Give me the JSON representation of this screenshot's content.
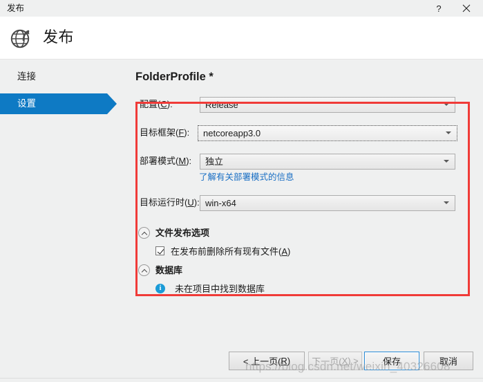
{
  "window": {
    "title": "发布",
    "help_label": "?",
    "close_label": "✕"
  },
  "header": {
    "title": "发布",
    "icon": "globe-publish-icon"
  },
  "sidebar": {
    "items": [
      {
        "label": "连接",
        "selected": false
      },
      {
        "label": "设置",
        "selected": true
      }
    ]
  },
  "main": {
    "profile_title": "FolderProfile *",
    "fields": [
      {
        "label_prefix": "配置(",
        "accel": "C",
        "label_suffix": "):",
        "value": "Release",
        "focused": false
      },
      {
        "label_prefix": "目标框架(",
        "accel": "F",
        "label_suffix": "):",
        "value": "netcoreapp3.0",
        "focused": true
      },
      {
        "label_prefix": "部署模式(",
        "accel": "M",
        "label_suffix": "):",
        "value": "独立",
        "focused": false
      },
      {
        "label_prefix": "目标运行时(",
        "accel": "U",
        "label_suffix": "):",
        "value": "win-x64",
        "focused": false
      }
    ],
    "deployment_hint_link": "了解有关部署模式的信息",
    "sections": [
      {
        "title": "文件发布选项",
        "checkbox": {
          "label_prefix": "在发布前删除所有现有文件(",
          "accel": "A",
          "label_suffix": ")",
          "checked": true
        }
      },
      {
        "title": "数据库",
        "info": {
          "icon": "info-icon",
          "glyph": "i",
          "text": "未在项目中找到数据库"
        }
      }
    ]
  },
  "footer": {
    "buttons": [
      {
        "name": "previous",
        "label": "< 上一页(R)",
        "prefix": "< 上一页(",
        "accel": "R",
        "suffix": ")",
        "state": "enabled"
      },
      {
        "name": "next",
        "label": "下一页(X) >",
        "prefix": "下一页(",
        "accel": "X",
        "suffix": ") >",
        "state": "disabled"
      },
      {
        "name": "save",
        "label": "保存",
        "prefix": "保存",
        "accel": "",
        "suffix": "",
        "state": "focused"
      },
      {
        "name": "cancel",
        "label": "取消",
        "prefix": "取消",
        "accel": "",
        "suffix": "",
        "state": "enabled"
      }
    ]
  },
  "watermark": "https://blog.csdn.net/weixin_40326608",
  "colors": {
    "accent_blue": "#0e7ac4",
    "link_blue": "#1a6fc4",
    "annotation_red": "#f03b38",
    "info_blue": "#1a9bd7",
    "background": "#eff0f0"
  }
}
